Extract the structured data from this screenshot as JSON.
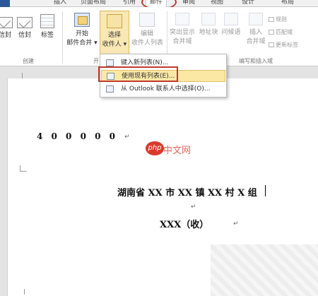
{
  "ribbon_tabs": {
    "file": "",
    "insert": "插入",
    "page_layout": "页面布局",
    "references": "引用",
    "mailings": "邮件",
    "review": "审阅",
    "view": "视图",
    "design": "设计",
    "layout": "布局"
  },
  "ribbon": {
    "envelopes_label": "信封",
    "envelopes2_label": "信封",
    "labels_label": "标签",
    "start_label_1": "开始",
    "start_label_2": "邮件合并",
    "select_label_1": "选择",
    "select_label_2": "收件人",
    "edit_label_1": "编辑",
    "edit_label_2": "收件人列表",
    "highlight_label_1": "突出显示",
    "highlight_label_2": "合并域",
    "address_label": "地址块",
    "greeting_label": "问候语",
    "insert_field_1": "插入",
    "insert_field_2": "合并域",
    "rules_label": "规则",
    "match_label": "匹配域",
    "update_label": "更新标签",
    "group_create": "创建",
    "group_start": "开",
    "group_write": "编写和插入域"
  },
  "dropdown": {
    "item1": "键入新列表(N)...",
    "item2": "使用现有列表(E)...",
    "item3": "从 Outlook 联系人中选择(O)..."
  },
  "document": {
    "postcode": "4 0 0 0 0 0",
    "address": "湖南省 XX 市 XX 镇 XX 村 X 组",
    "recipient": "XXX（收）"
  },
  "watermark": {
    "brand": "php",
    "text": "中文网"
  },
  "colors": {
    "file_tab": "#2b579a",
    "highlight_red": "#c0392b",
    "selection_yellow": "#fbe8a5"
  }
}
